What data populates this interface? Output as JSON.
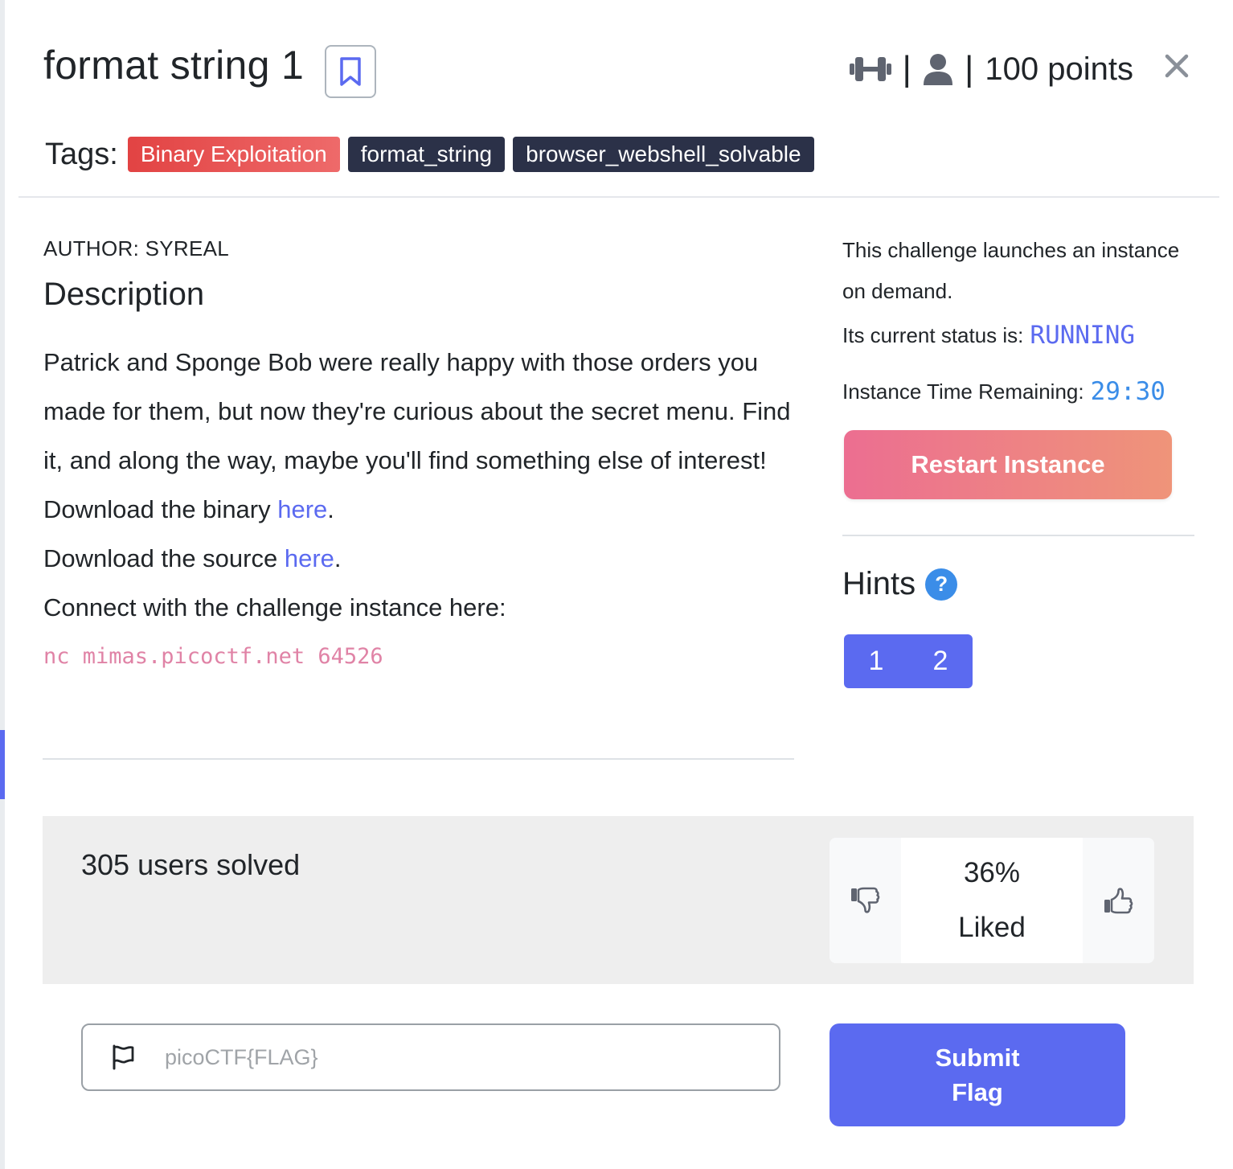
{
  "challenge": {
    "title": "format string 1",
    "points": "100 points",
    "separator": "|"
  },
  "tags": {
    "label": "Tags:",
    "items": [
      "Binary Exploitation",
      "format_string",
      "browser_webshell_solvable"
    ]
  },
  "description": {
    "author": "AUTHOR: SYREAL",
    "heading": "Description",
    "paragraph": "Patrick and Sponge Bob were really happy with those orders you made for them, but now they're curious about the secret menu. Find it, and along the way, maybe you'll find something else of interest!",
    "binary_prefix": "Download the binary ",
    "binary_link": "here",
    "source_prefix": "Download the source ",
    "source_link": "here",
    "period": ".",
    "connect_text": "Connect with the challenge instance here:",
    "nc_command": "nc mimas.picoctf.net 64526"
  },
  "instance": {
    "launch_text": "This challenge launches an instance on demand.",
    "status_label": "Its current status is:",
    "status_value": "RUNNING",
    "time_label": "Instance Time Remaining:",
    "time_value": "29:30",
    "restart_label": "Restart Instance"
  },
  "hints": {
    "heading": "Hints",
    "help_glyph": "?",
    "buttons": [
      "1",
      "2"
    ]
  },
  "stats": {
    "solved_text": "305 users solved",
    "liked_percent": "36%",
    "liked_label": "Liked"
  },
  "flag": {
    "placeholder": "picoCTF{FLAG}",
    "submit_line1": "Submit",
    "submit_line2": "Flag"
  },
  "icons": {
    "difficulty": "dumbbell-icon",
    "user": "user-icon",
    "close": "close-icon",
    "bookmark": "bookmark-icon",
    "flag": "flag-icon",
    "thumbs_down": "thumbs-down-icon",
    "thumbs_up": "thumbs-up-icon"
  },
  "colors": {
    "accent": "#5b6af0",
    "tag_red": "#e24343",
    "tag_dark": "#2b3148",
    "status_blue": "#5b6af0",
    "time_blue": "#3b8de8",
    "nc_pink": "#e083a6",
    "restart_gradient_start": "#ec6e91",
    "restart_gradient_end": "#ef9479"
  }
}
